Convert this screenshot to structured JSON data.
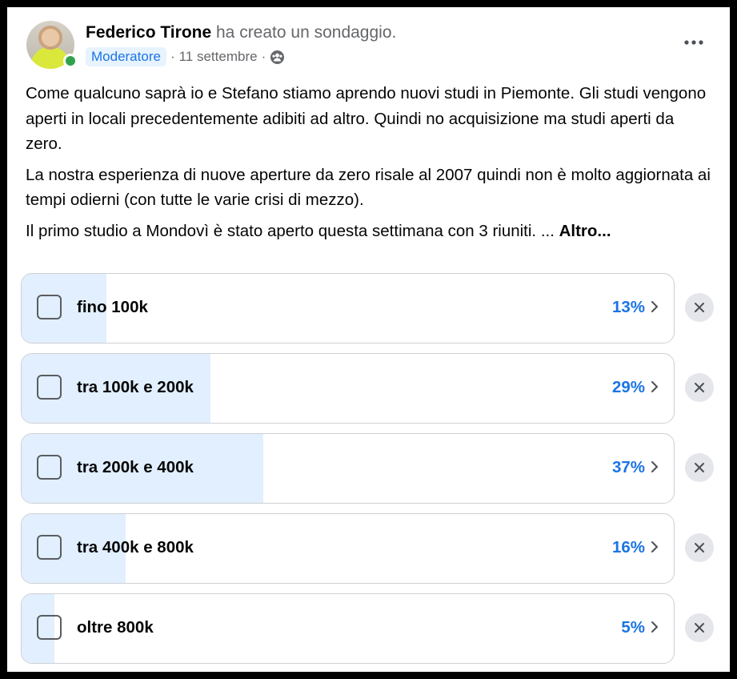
{
  "post": {
    "author": "Federico Tirone",
    "action": "ha creato un sondaggio.",
    "role_badge": "Moderatore",
    "date": "11 settembre",
    "separator": "·",
    "audience_icon": "group-icon",
    "paragraphs": [
      "Come qualcuno saprà io e Stefano stiamo aprendo nuovi studi in Piemonte. Gli studi vengono aperti in locali precedentemente adibiti ad altro. Quindi no acquisizione ma studi aperti da zero.",
      "La nostra esperienza di nuove aperture da zero risale al 2007 quindi non è molto aggiornata ai tempi odierni (con tutte le varie crisi di mezzo).",
      "Il primo studio a Mondovì è stato aperto questa settimana con 3 riuniti. ..."
    ],
    "see_more": "Altro..."
  },
  "poll": {
    "options": [
      {
        "label": "fino 100k",
        "percent_text": "13%",
        "percent": 13
      },
      {
        "label": "tra 100k e 200k",
        "percent_text": "29%",
        "percent": 29
      },
      {
        "label": "tra 200k e 400k",
        "percent_text": "37%",
        "percent": 37
      },
      {
        "label": "tra 400k e 800k",
        "percent_text": "16%",
        "percent": 16
      },
      {
        "label": "oltre 800k",
        "percent_text": "5%",
        "percent": 5
      }
    ]
  },
  "colors": {
    "accent": "#1b74e4",
    "poll_fill": "#e1effe",
    "online": "#31a24c"
  }
}
